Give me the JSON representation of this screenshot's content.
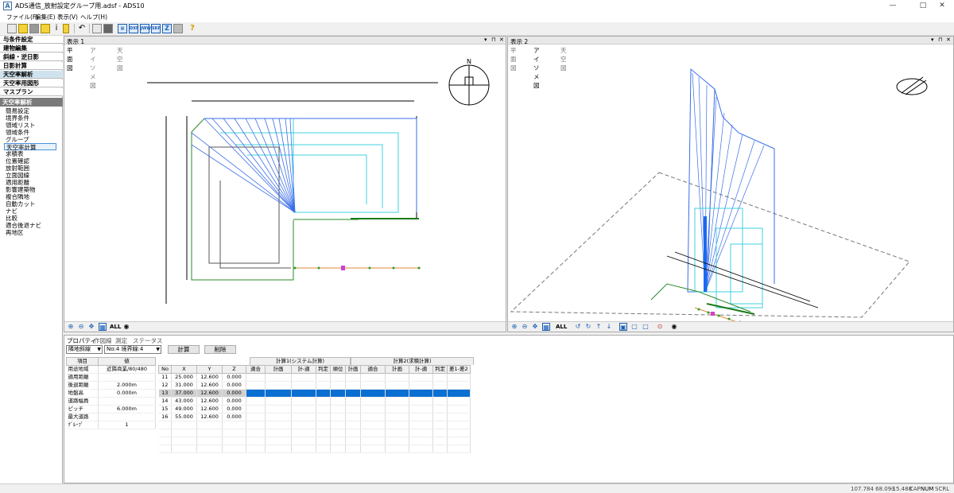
{
  "window": {
    "title": "ADS通信_放射設定グループ用.adsf - ADS10",
    "app_icon": "A"
  },
  "menu": [
    "ファイル(F)",
    "編集(E)",
    "表示(V)",
    "ヘルプ(H)"
  ],
  "toolbar": {
    "dxf": "DXF",
    "jww": "JWW",
    "skp": "SKP"
  },
  "left": {
    "headers": [
      "与条件設定",
      "建物編集",
      "斜線・逆日影",
      "日影計算",
      "天空率解析",
      "天空率用図形",
      "マスプラン"
    ],
    "active_header": "天空率解析",
    "section": "天空率解析",
    "items": [
      "簡易設定",
      "境界条件",
      "領域リスト",
      "領域条件",
      "グループ",
      "天空率計算",
      "求積表",
      "位置確認",
      "放射範囲",
      "立面図線",
      "適用距離",
      "影響建築物",
      "複合隣地",
      "自動カット",
      "ナビ",
      "比較",
      "適合後退ナビ",
      "再地区"
    ],
    "selected": "天空率計算"
  },
  "view1": {
    "title": "表示 1",
    "tabs": [
      "平面図",
      "アイソメ図",
      "天空図"
    ],
    "active_tab": "平面図",
    "compass": "N"
  },
  "view2": {
    "title": "表示 2",
    "tabs": [
      "平面図",
      "アイソメ図",
      "天空図"
    ],
    "active_tab": "アイソメ図"
  },
  "view_toolbar": {
    "all_label": "ALL"
  },
  "view_controls": {
    "menu": "▾",
    "pin": "⊓",
    "close": "✕"
  },
  "bottom": {
    "tabs": [
      "プロパティ",
      "作図線",
      "測定",
      "ステータス"
    ],
    "active_tab": "プロパティ",
    "select1": "隣地斜線",
    "select2": "No:4 境界線:4",
    "calc_button": "計算",
    "delete_button": "削除",
    "prop_headers": [
      "項目",
      "値"
    ],
    "props": [
      {
        "k": "用途地域",
        "v": "近隣商業/80/480"
      },
      {
        "k": "適用距離",
        "v": ""
      },
      {
        "k": "後退距離",
        "v": "2.000m"
      },
      {
        "k": "地盤高",
        "v": "0.000m"
      },
      {
        "k": "道路幅員",
        "v": ""
      },
      {
        "k": "ピッチ",
        "v": "6.000m"
      },
      {
        "k": "最大道路",
        "v": ""
      },
      {
        "k": "ｸﾞﾙｰﾌﾟ",
        "v": "1"
      }
    ],
    "group_headers": [
      "計算1(システム計算)",
      "計算2(求積計算)"
    ],
    "col_headers": [
      "No",
      "X",
      "Y",
      "Z",
      "適合",
      "計画",
      "計-適",
      "判定",
      "順位",
      "計画",
      "適合",
      "計画",
      "計-適",
      "判定",
      "差1-差2"
    ],
    "rows": [
      {
        "no": "11",
        "x": "25.000",
        "y": "12.600",
        "z": "0.000"
      },
      {
        "no": "12",
        "x": "31.000",
        "y": "12.600",
        "z": "0.000"
      },
      {
        "no": "13",
        "x": "37.000",
        "y": "12.600",
        "z": "0.000"
      },
      {
        "no": "14",
        "x": "43.000",
        "y": "12.600",
        "z": "0.000"
      },
      {
        "no": "15",
        "x": "49.000",
        "y": "12.600",
        "z": "0.000"
      },
      {
        "no": "16",
        "x": "55.000",
        "y": "12.600",
        "z": "0.000"
      }
    ],
    "selected_row": "13"
  },
  "status": {
    "coords": "107.784  68.093",
    "z": "-15.488",
    "cap": "CAP",
    "num": "NUM",
    "scrl": "SCRL"
  }
}
